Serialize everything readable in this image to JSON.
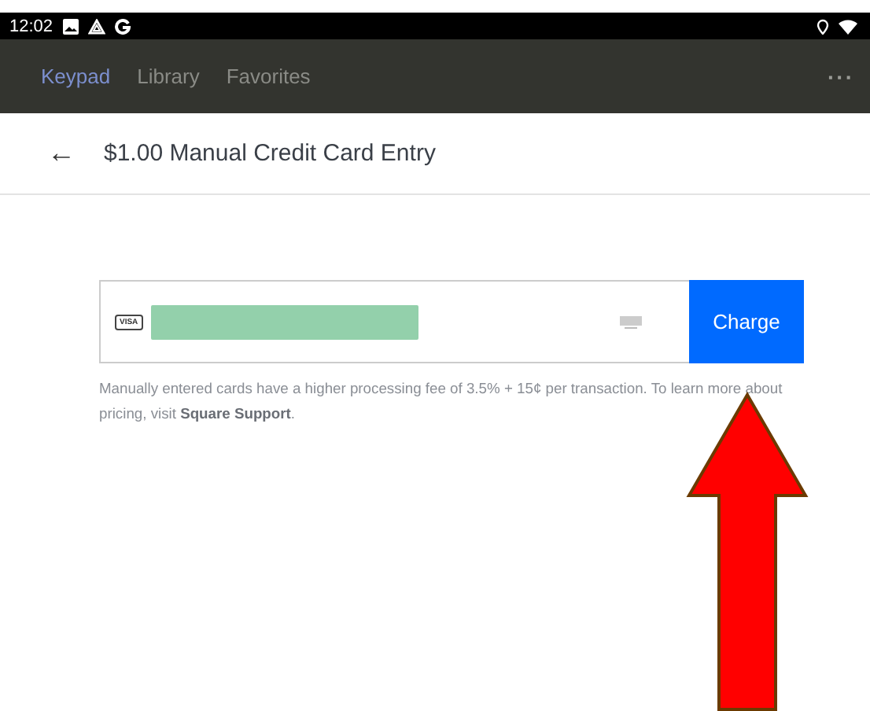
{
  "status_bar": {
    "time": "12:02"
  },
  "tabs": [
    {
      "label": "Keypad",
      "selected": true
    },
    {
      "label": "Library",
      "selected": false
    },
    {
      "label": "Favorites",
      "selected": false
    }
  ],
  "menu": {
    "label": "···"
  },
  "header": {
    "back": "←",
    "title": "$1.00 Manual Credit Card Entry"
  },
  "card_field": {
    "brand": "VISA",
    "redacted": true
  },
  "charge_button": {
    "label": "Charge"
  },
  "note": {
    "text": "Manually entered cards have a higher processing fee of 3.5% + 15¢ per transaction. To learn more about pricing, visit ",
    "link": "Square Support",
    "end": "."
  },
  "annotation": {
    "kind": "arrow"
  }
}
